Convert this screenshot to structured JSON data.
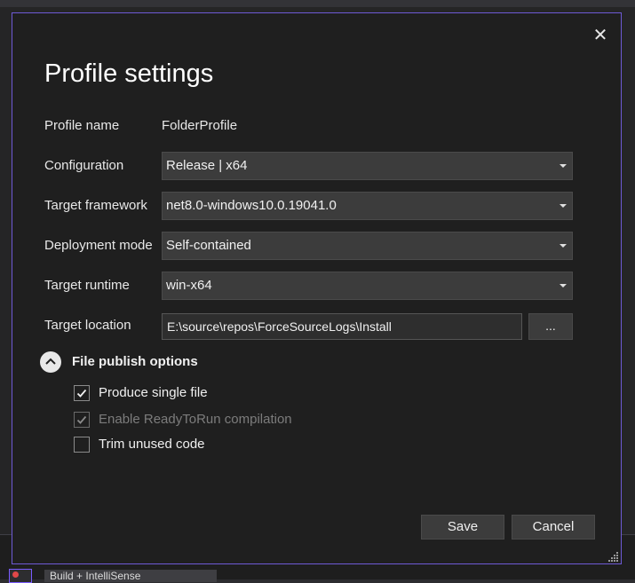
{
  "dialog": {
    "title": "Profile settings",
    "close_label": "✕"
  },
  "fields": {
    "profile_name": {
      "label": "Profile name",
      "value": "FolderProfile"
    },
    "configuration": {
      "label": "Configuration",
      "value": "Release | x64"
    },
    "target_framework": {
      "label": "Target framework",
      "value": "net8.0-windows10.0.19041.0"
    },
    "deployment_mode": {
      "label": "Deployment mode",
      "value": "Self-contained"
    },
    "target_runtime": {
      "label": "Target runtime",
      "value": "win-x64"
    },
    "target_location": {
      "label": "Target location",
      "value": "E:\\source\\repos\\ForceSourceLogs\\Install",
      "browse_label": "..."
    }
  },
  "publish_options": {
    "title": "File publish options",
    "expanded": true,
    "options": [
      {
        "label": "Produce single file",
        "checked": true,
        "enabled": true
      },
      {
        "label": "Enable ReadyToRun compilation",
        "checked": true,
        "enabled": false
      },
      {
        "label": "Trim unused code",
        "checked": false,
        "enabled": true
      }
    ]
  },
  "buttons": {
    "save_label": "Save",
    "cancel_label": "Cancel"
  },
  "background": {
    "status_text": "Build + IntelliSense"
  },
  "colors": {
    "dialog_bg": "#1f1f1f",
    "dialog_border": "#6e5ad6",
    "control_bg": "#3c3c3c",
    "text": "#f0f0f0",
    "disabled_text": "#7c7c7c"
  }
}
